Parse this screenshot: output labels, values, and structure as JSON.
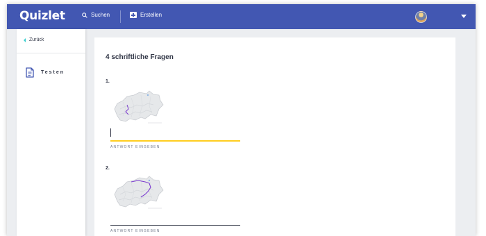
{
  "header": {
    "logo": "Quizlet",
    "search_label": "Suchen",
    "create_label": "Erstellen"
  },
  "sidebar": {
    "back_label": "Zurück",
    "mode_label": "Testen"
  },
  "main": {
    "heading": "4 schriftliche Fragen",
    "questions": [
      {
        "number": "1.",
        "answer_value": "",
        "answer_label": "ANTWORT EINGEBEN",
        "state": "active"
      },
      {
        "number": "2.",
        "answer_value": "",
        "answer_label": "ANTWORT EINGEBEN",
        "state": "idle"
      }
    ]
  },
  "colors": {
    "header_bg": "#4257b2",
    "active_underline": "#ffcd1f",
    "back_chevron": "#3ccfcf",
    "route_line": "#7b3ccf"
  }
}
